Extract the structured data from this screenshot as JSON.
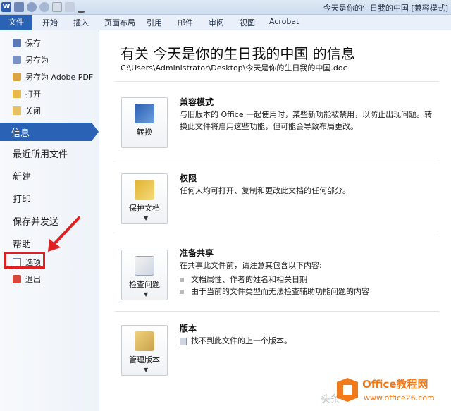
{
  "window": {
    "title": "今天是你的生日我的中国 [兼容模式]",
    "app_letter": "W"
  },
  "ribbon": {
    "file_tab": "文件",
    "tabs": [
      "开始",
      "插入",
      "页面布局",
      "引用",
      "邮件",
      "审阅",
      "视图",
      "Acrobat"
    ]
  },
  "sidebar": {
    "small_items": [
      {
        "label": "保存",
        "icon": "save-icon"
      },
      {
        "label": "另存为",
        "icon": "save-as-icon"
      },
      {
        "label": "另存为 Adobe PDF",
        "icon": "pdf-icon"
      },
      {
        "label": "打开",
        "icon": "open-folder-icon"
      },
      {
        "label": "关闭",
        "icon": "close-folder-icon"
      }
    ],
    "active_item": "信息",
    "big_items": [
      "最近所用文件",
      "新建",
      "打印",
      "保存并发送",
      "帮助"
    ],
    "bottom_items": [
      {
        "label": "选项",
        "icon": "options-icon"
      },
      {
        "label": "退出",
        "icon": "exit-icon"
      }
    ]
  },
  "main": {
    "title": "有关 今天是你的生日我的中国 的信息",
    "path": "C:\\Users\\Administrator\\Desktop\\今天是你的生日我的中国.doc",
    "sections": [
      {
        "button_label": "转换",
        "button_icon": "word-convert-icon",
        "title": "兼容模式",
        "desc": "与旧版本的 Office 一起使用时，某些新功能被禁用，以防止出现问题。转换此文件将启用这些功能，但可能会导致布局更改。"
      },
      {
        "button_label": "保护文档",
        "button_icon": "lock-key-icon",
        "title": "权限",
        "desc": "任何人均可打开、复制和更改此文档的任何部分。"
      },
      {
        "button_label": "检查问题",
        "button_icon": "checklist-icon",
        "title": "准备共享",
        "desc": "在共享此文件前，请注意其包含以下内容:",
        "bullets": [
          "文档属性、作者的姓名和相关日期",
          "由于当前的文件类型而无法检查辅助功能问题的内容"
        ]
      },
      {
        "button_label": "管理版本",
        "button_icon": "versions-icon",
        "title": "版本",
        "desc": "找不到此文件的上一个版本。"
      }
    ]
  },
  "watermark": {
    "brand": "Office教程网",
    "url": "www.office26.com",
    "left_text": "头条"
  },
  "colors": {
    "accent": "#2a63b5",
    "highlight": "#e02020",
    "watermark_orange": "#f07a1a"
  }
}
